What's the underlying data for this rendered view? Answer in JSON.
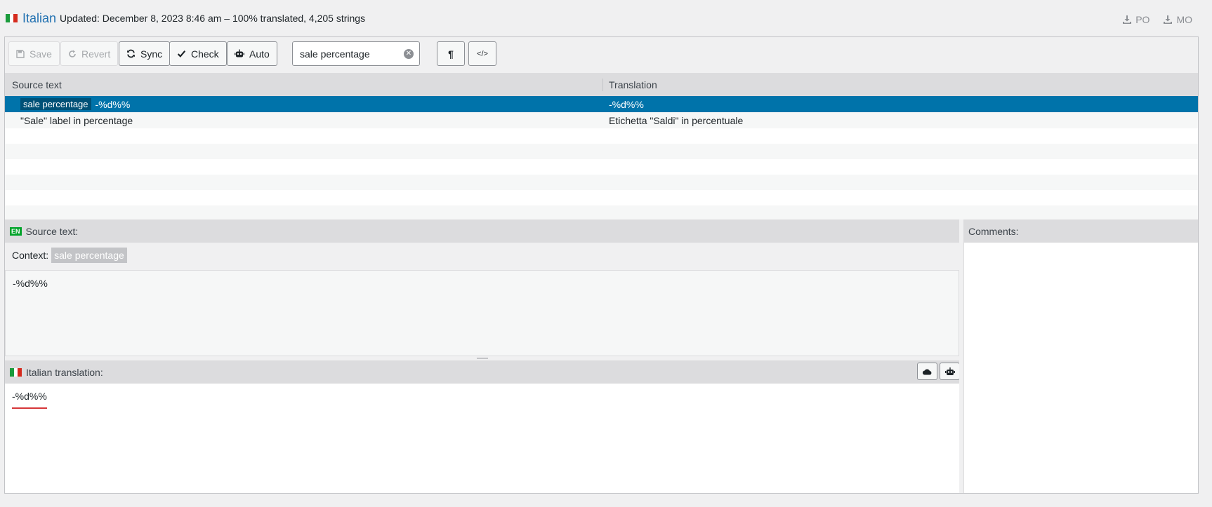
{
  "header": {
    "language": "Italian",
    "updated_text": "Updated: December 8, 2023 8:46 am – 100% translated, 4,205 strings",
    "downloads": [
      {
        "label": "PO",
        "icon": "download-icon"
      },
      {
        "label": "MO",
        "icon": "download-icon"
      }
    ]
  },
  "toolbar": {
    "save_label": "Save",
    "revert_label": "Revert",
    "sync_label": "Sync",
    "check_label": "Check",
    "auto_label": "Auto",
    "search_value": "sale percentage",
    "pilcrow_label": "¶",
    "code_label": "</>"
  },
  "grid": {
    "col_source": "Source text",
    "col_translation": "Translation",
    "rows": [
      {
        "context": "sale percentage",
        "source": "-%d%%",
        "translation": "-%d%%",
        "selected": true
      },
      {
        "context": "",
        "source": "\"Sale\" label in percentage",
        "translation": "Etichetta \"Saldi\" in percentuale",
        "selected": false
      }
    ]
  },
  "source_panel": {
    "badge": "EN",
    "title": "Source text:",
    "context_label": "Context:",
    "context_value": "sale percentage",
    "text": "-%d%%"
  },
  "translation_panel": {
    "title": "Italian translation:",
    "text": "-%d%%"
  },
  "comments_panel": {
    "title": "Comments:"
  },
  "colors": {
    "accent": "#0073aa",
    "link": "#2271b1",
    "error_underline": "#d63638"
  }
}
